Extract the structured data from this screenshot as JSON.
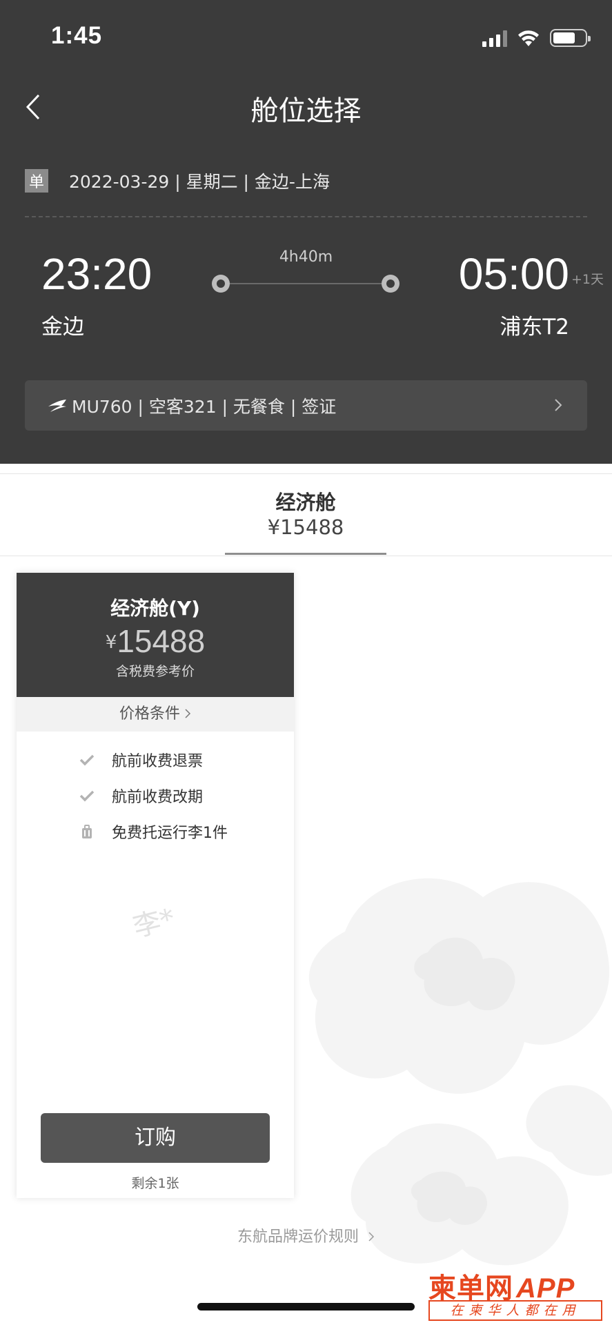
{
  "status_bar": {
    "time": "1:45"
  },
  "nav": {
    "title": "舱位选择"
  },
  "trip": {
    "badge": "单",
    "summary": "2022-03-29 | 星期二 | 金边-上海"
  },
  "flight": {
    "departure_time": "23:20",
    "departure_city": "金边",
    "arrival_time": "05:00",
    "arrival_day_offset": "+1天",
    "arrival_city": "浦东T2",
    "duration": "4h40m",
    "details": "MU760 | 空客321 | 无餐食 | 签证"
  },
  "tab": {
    "label": "经济舱",
    "price": "¥15488"
  },
  "fare_card": {
    "name": "经济舱(Y)",
    "currency": "¥",
    "price": "15488",
    "price_note": "含税费参考价",
    "conditions_link": "价格条件",
    "features": [
      {
        "icon": "check-icon",
        "text": "航前收费退票"
      },
      {
        "icon": "check-icon",
        "text": "航前收费改期"
      },
      {
        "icon": "luggage-icon",
        "text": "免费托运行李1件"
      }
    ],
    "watermark": "李*",
    "book_label": "订购",
    "remaining": "剩余1张"
  },
  "rules_link": "东航品牌运价规则",
  "brand": {
    "name": "柬单网",
    "suffix": "APP",
    "slogan": "在柬华人都在用"
  },
  "colors": {
    "header_bg": "#3b3b3b",
    "brand_red": "#e6471f"
  }
}
